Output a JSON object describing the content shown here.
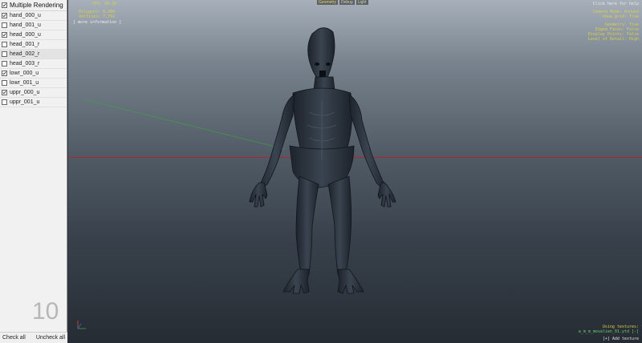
{
  "panel": {
    "header_label": "Multiple Rendering",
    "header_checked": true,
    "items": [
      {
        "label": "hand_000_u",
        "checked": true
      },
      {
        "label": "hand_001_u",
        "checked": false
      },
      {
        "label": "head_000_u",
        "checked": true
      },
      {
        "label": "head_001_r",
        "checked": false
      },
      {
        "label": "head_002_r",
        "checked": false
      },
      {
        "label": "head_003_r",
        "checked": false
      },
      {
        "label": "lowr_000_u",
        "checked": true
      },
      {
        "label": "lowr_001_u",
        "checked": false
      },
      {
        "label": "uppr_000_u",
        "checked": true
      },
      {
        "label": "uppr_001_u",
        "checked": false
      }
    ],
    "count": "10",
    "check_all": "Check all",
    "uncheck_all": "Uncheck all"
  },
  "viewport": {
    "tabs": [
      "Geometry",
      "Debug",
      "Light"
    ],
    "fps": "FPS: 59.28",
    "polygons": "Polygons: 8,984",
    "vertices": "Vertices: 7,792",
    "more_info": "[ more information ]",
    "help": "Click here for help",
    "camera_mode": "Camera Mode: Around",
    "show_grid": "Show grid: True",
    "geometry": "Geometry: True",
    "edged_faces": "Edged Faces: False",
    "display_points": "Display Points: False",
    "level_of_detail": "Level of Detail: High",
    "using_textures": "Using textures:",
    "texture_file": "a_m_m_movalien_01.ytd [-]",
    "add_texture": "[+] Add texture"
  },
  "colors": {
    "hud_yellow": "#d9cf4a",
    "horizon_red": "#b3242e",
    "axis_green": "#3aa83a"
  }
}
